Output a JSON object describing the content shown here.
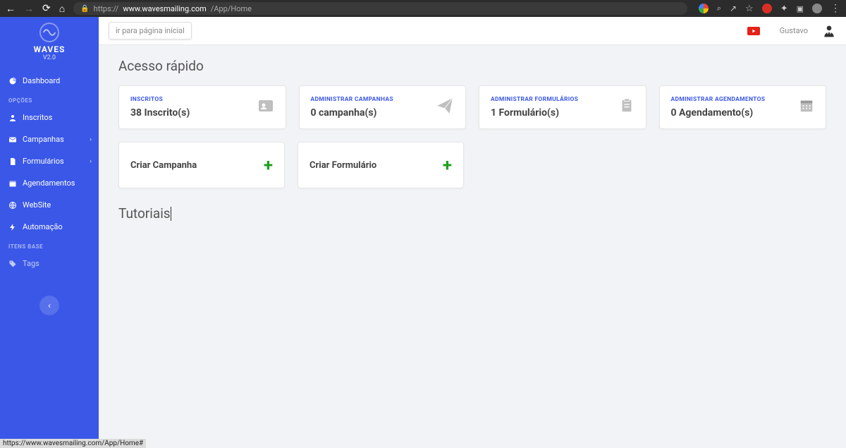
{
  "browser": {
    "url_prefix": "https://",
    "url_host": "www.wavesmailing.com",
    "url_path": "/App/Home",
    "status_link": "https://www.wavesmailing.com/App/Home#"
  },
  "brand": {
    "title": "WAVES",
    "subtitle": "V2.0"
  },
  "sidebar": {
    "dashboard": "Dashboard",
    "heading_opcoes": "OPÇÕES",
    "inscritos": "Inscritos",
    "campanhas": "Campanhas",
    "formularios": "Formulários",
    "agendamentos": "Agendamentos",
    "website": "WebSite",
    "automacao": "Automação",
    "heading_itens": "ITENS BASE",
    "tags": "Tags"
  },
  "topbar": {
    "tooltip": "ir para página inicial",
    "user": "Gustavo"
  },
  "quick": {
    "title": "Acesso rápido",
    "cards": [
      {
        "label": "INSCRITOS",
        "value": "38 Inscrito(s)"
      },
      {
        "label": "ADMINISTRAR CAMPANHAS",
        "value": "0 campanha(s)"
      },
      {
        "label": "ADMINISTRAR FORMULÁRIOS",
        "value": "1 Formulário(s)"
      },
      {
        "label": "ADMINISTRAR AGENDAMENTOS",
        "value": "0 Agendamento(s)"
      }
    ],
    "actions": [
      {
        "label": "Criar Campanha"
      },
      {
        "label": "Criar Formulário"
      }
    ]
  },
  "tutorials": {
    "title": "Tutoriais"
  }
}
